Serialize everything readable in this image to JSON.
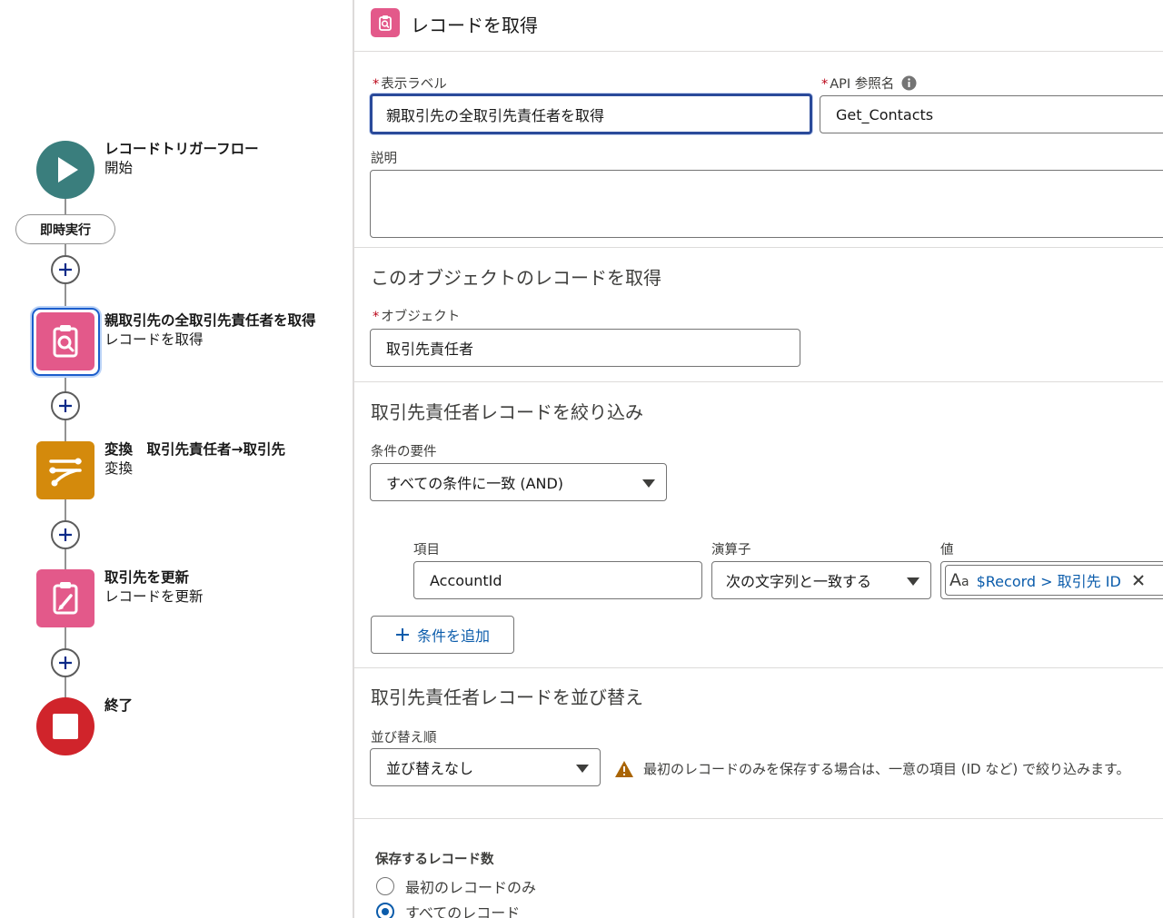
{
  "flow": {
    "start": {
      "title": "レコードトリガーフロー",
      "subtitle": "開始"
    },
    "run_pill": "即時実行",
    "get_records": {
      "title": "親取引先の全取引先責任者を取得",
      "subtitle": "レコードを取得"
    },
    "transform": {
      "title": "変換　取引先責任者→取引先",
      "subtitle": "変換"
    },
    "update": {
      "title": "取引先を更新",
      "subtitle": "レコードを更新"
    },
    "end": {
      "title": "終了"
    },
    "colors": {
      "start": "#3a7e7d",
      "get": "#e3598a",
      "transform": "#d48a0c",
      "update": "#e3598a",
      "end": "#d0242b"
    }
  },
  "panel": {
    "header_title": "レコードを取得",
    "label_field": {
      "label": "表示ラベル",
      "required": "*",
      "value": "親取引先の全取引先責任者を取得"
    },
    "api_field": {
      "label": "API 参照名",
      "required": "*",
      "value": "Get_Contacts"
    },
    "description": {
      "label": "説明"
    },
    "object_section": {
      "title": "このオブジェクトのレコードを取得",
      "object_label": "オブジェクト",
      "required": "*",
      "object_value": "取引先責任者"
    },
    "filter_section": {
      "title": "取引先責任者レコードを絞り込み",
      "condition_label": "条件の要件",
      "condition_value": "すべての条件に一致 (AND)",
      "columns": {
        "field": "項目",
        "operator": "演算子",
        "value": "値"
      },
      "row": {
        "field": "AccountId",
        "operator": "次の文字列と一致する",
        "value_record": "$Record",
        "value_separator": ">",
        "value_field": "取引先 ID"
      },
      "add_condition": "条件を追加"
    },
    "sort_section": {
      "title": "取引先責任者レコードを並び替え",
      "order_label": "並び替え順",
      "order_value": "並び替えなし",
      "warning": "最初のレコードのみを保存する場合は、一意の項目 (ID など) で絞り込みます。"
    },
    "store_section": {
      "title": "保存するレコード数",
      "options": [
        "最初のレコードのみ",
        "すべてのレコード"
      ],
      "selected_index": 1
    }
  }
}
